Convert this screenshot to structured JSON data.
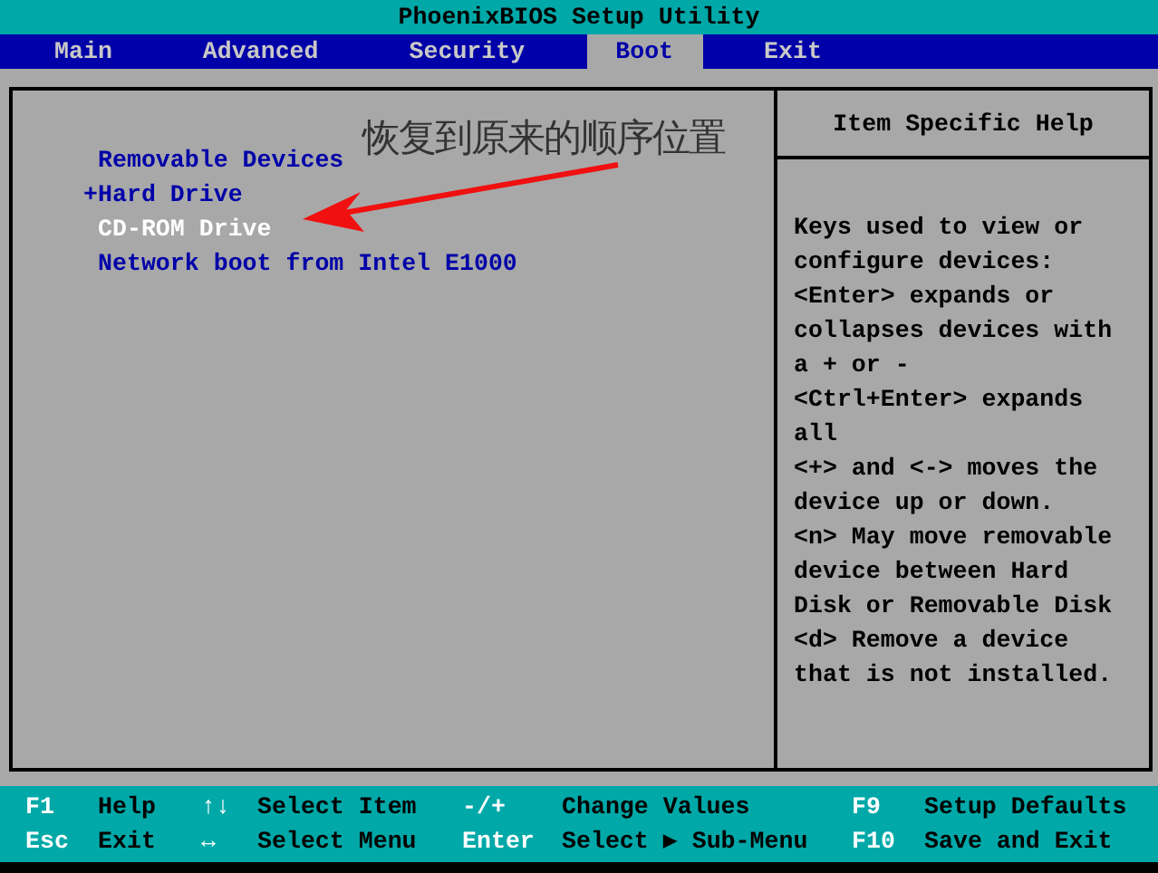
{
  "window": {
    "title": "PhoenixBIOS Setup Utility"
  },
  "tabs": [
    {
      "label": "Main",
      "selected": false
    },
    {
      "label": "Advanced",
      "selected": false
    },
    {
      "label": "Security",
      "selected": false
    },
    {
      "label": "Boot",
      "selected": true
    },
    {
      "label": "Exit",
      "selected": false
    }
  ],
  "boot_items": [
    {
      "label": "Removable Devices",
      "selected": false
    },
    {
      "label": "Hard Drive",
      "expander": "+",
      "selected": false
    },
    {
      "label": "CD-ROM Drive",
      "selected": true
    },
    {
      "label": "Network boot from Intel E1000",
      "selected": false
    }
  ],
  "annotation": {
    "text": "恢复到原来的顺序位置"
  },
  "help": {
    "title": "Item Specific Help",
    "lines": [
      "Keys used to view or",
      "configure devices:",
      "<Enter> expands or",
      "collapses devices with",
      "a + or -",
      "<Ctrl+Enter> expands",
      "all",
      "<+> and <-> moves the",
      "device up or down.",
      "<n> May move removable",
      "device between Hard",
      "Disk or Removable Disk",
      "<d> Remove a device",
      "that is not installed."
    ]
  },
  "footer": [
    [
      {
        "key": "F1",
        "action": "Help"
      },
      {
        "key": "↑↓",
        "action": "Select Item"
      },
      {
        "key": "-/+",
        "action": "Change Values"
      },
      {
        "key": "F9",
        "action": "Setup Defaults"
      }
    ],
    [
      {
        "key": "Esc",
        "action": "Exit"
      },
      {
        "key": "↔",
        "action": "Select Menu"
      },
      {
        "key": "Enter",
        "action": "Select ▶ Sub-Menu"
      },
      {
        "key": "F10",
        "action": "Save and Exit"
      }
    ]
  ]
}
